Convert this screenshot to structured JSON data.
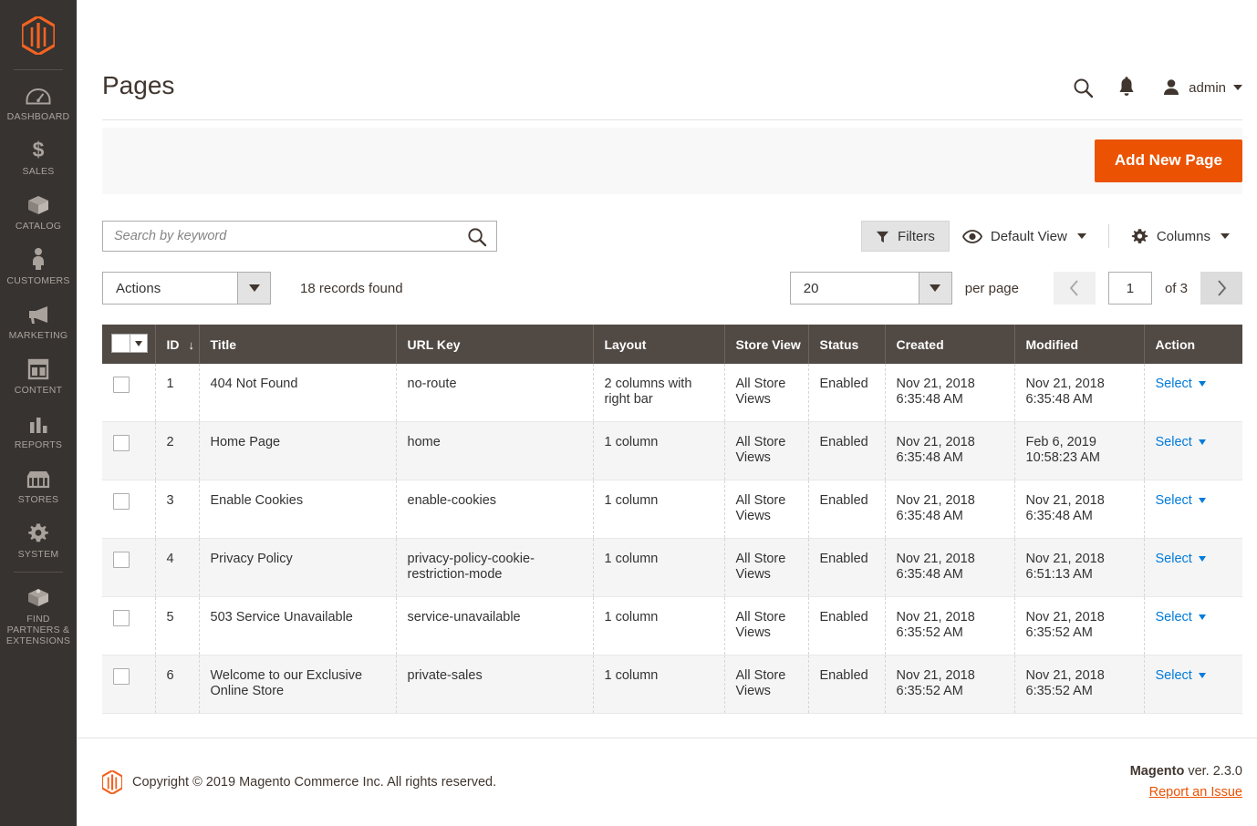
{
  "sidebar": {
    "logo_name": "magento-logo",
    "items": [
      {
        "label": "DASHBOARD",
        "icon": "dashboard-icon"
      },
      {
        "label": "SALES",
        "icon": "dollar-icon"
      },
      {
        "label": "CATALOG",
        "icon": "box-icon"
      },
      {
        "label": "CUSTOMERS",
        "icon": "person-icon"
      },
      {
        "label": "MARKETING",
        "icon": "megaphone-icon"
      },
      {
        "label": "CONTENT",
        "icon": "layout-icon"
      },
      {
        "label": "REPORTS",
        "icon": "bar-chart-icon"
      },
      {
        "label": "STORES",
        "icon": "storefront-icon"
      },
      {
        "label": "SYSTEM",
        "icon": "gear-icon"
      },
      {
        "label": "FIND PARTNERS & EXTENSIONS",
        "icon": "puzzle-block-icon"
      }
    ]
  },
  "header": {
    "title": "Pages",
    "search_icon": "search-icon",
    "notifications_icon": "bell-icon",
    "admin_label": "admin",
    "avatar_icon": "user-avatar-icon"
  },
  "page_actions": {
    "add_new_page_label": "Add New Page"
  },
  "toolbar": {
    "search_placeholder": "Search by keyword",
    "search_value": "",
    "filters_label": "Filters",
    "filters_icon": "funnel-icon",
    "view_label": "Default View",
    "view_icon": "eye-icon",
    "columns_label": "Columns",
    "columns_icon": "gear-icon"
  },
  "grid_controls": {
    "actions_label": "Actions",
    "records_found": "18 records found",
    "per_page_value": "20",
    "per_page_label": "per page",
    "page_value": "1",
    "of_total": "of 3",
    "prev_icon": "chevron-left-icon",
    "next_icon": "chevron-right-icon"
  },
  "table": {
    "columns": [
      {
        "key": "checkbox",
        "label": ""
      },
      {
        "key": "id",
        "label": "ID",
        "sort": "↓"
      },
      {
        "key": "title",
        "label": "Title"
      },
      {
        "key": "url_key",
        "label": "URL Key"
      },
      {
        "key": "layout",
        "label": "Layout"
      },
      {
        "key": "store_view",
        "label": "Store View"
      },
      {
        "key": "status",
        "label": "Status"
      },
      {
        "key": "created",
        "label": "Created"
      },
      {
        "key": "modified",
        "label": "Modified"
      },
      {
        "key": "action",
        "label": "Action"
      }
    ],
    "action_label": "Select",
    "rows": [
      {
        "id": "1",
        "title": "404 Not Found",
        "url_key": "no-route",
        "layout": "2 columns with right bar",
        "store_view": "All Store Views",
        "status": "Enabled",
        "created_date": "Nov 21, 2018",
        "created_time": "6:35:48 AM",
        "modified_date": "Nov 21, 2018",
        "modified_time": "6:35:48 AM"
      },
      {
        "id": "2",
        "title": "Home Page",
        "url_key": "home",
        "layout": "1 column",
        "store_view": "All Store Views",
        "status": "Enabled",
        "created_date": "Nov 21, 2018",
        "created_time": "6:35:48 AM",
        "modified_date": "Feb 6, 2019",
        "modified_time": "10:58:23 AM"
      },
      {
        "id": "3",
        "title": "Enable Cookies",
        "url_key": "enable-cookies",
        "layout": "1 column",
        "store_view": "All Store Views",
        "status": "Enabled",
        "created_date": "Nov 21, 2018",
        "created_time": "6:35:48 AM",
        "modified_date": "Nov 21, 2018",
        "modified_time": "6:35:48 AM"
      },
      {
        "id": "4",
        "title": "Privacy Policy",
        "url_key": "privacy-policy-cookie-restriction-mode",
        "layout": "1 column",
        "store_view": "All Store Views",
        "status": "Enabled",
        "created_date": "Nov 21, 2018",
        "created_time": "6:35:48 AM",
        "modified_date": "Nov 21, 2018",
        "modified_time": "6:51:13 AM"
      },
      {
        "id": "5",
        "title": "503 Service Unavailable",
        "url_key": "service-unavailable",
        "layout": "1 column",
        "store_view": "All Store Views",
        "status": "Enabled",
        "created_date": "Nov 21, 2018",
        "created_time": "6:35:52 AM",
        "modified_date": "Nov 21, 2018",
        "modified_time": "6:35:52 AM"
      },
      {
        "id": "6",
        "title": "Welcome to our Exclusive Online Store",
        "url_key": "private-sales",
        "layout": "1 column",
        "store_view": "All Store Views",
        "status": "Enabled",
        "created_date": "Nov 21, 2018",
        "created_time": "6:35:52 AM",
        "modified_date": "Nov 21, 2018",
        "modified_time": "6:35:52 AM"
      }
    ]
  },
  "footer": {
    "copyright": "Copyright © 2019 Magento Commerce Inc. All rights reserved.",
    "brand": "Magento",
    "version": " ver. 2.3.0",
    "report_link": "Report an Issue"
  },
  "colors": {
    "accent_orange": "#eb5202",
    "sidebar_bg": "#373330",
    "table_header_bg": "#514943",
    "link_blue": "#007bdb"
  }
}
